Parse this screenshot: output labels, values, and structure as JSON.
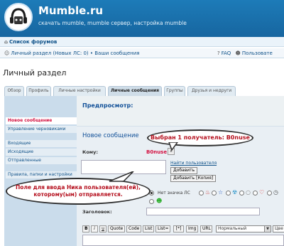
{
  "header": {
    "title": "Mumble.ru",
    "description": "скачать mumble, mumble сервер, настройка mumble"
  },
  "nav": {
    "forum_list": "Список форумов",
    "private_section": "Личный раздел (Новых ЛС: 0) • Ваши сообщения",
    "faq": "FAQ",
    "users": "Пользовате"
  },
  "page_title": "Личный раздел",
  "tabs": [
    {
      "label": "Обзор",
      "active": false
    },
    {
      "label": "Профиль",
      "active": false
    },
    {
      "label": "Личные настройки",
      "active": false
    },
    {
      "label": "Личные сообщения",
      "active": true
    },
    {
      "label": "Группы",
      "active": false
    },
    {
      "label": "Друзья и недруги",
      "active": false
    }
  ],
  "sidebar": {
    "items": [
      {
        "label": "Новое сообщение",
        "active": true
      },
      {
        "label": "Управление черновиками",
        "active": false
      },
      {
        "label": "Входящие",
        "active": false
      },
      {
        "label": "Исходящие",
        "active": false
      },
      {
        "label": "Отправленные",
        "active": false
      },
      {
        "label": "Правила, папки и настройки",
        "active": false
      }
    ]
  },
  "preview": {
    "title": "Предпросмотр:"
  },
  "compose": {
    "section_title": "Новое сообщение",
    "to_label": "Кому:",
    "recipient": "B0nuse",
    "remove_label": "x",
    "find_user": "Найти пользователя",
    "add_button": "Добавить",
    "add_bcc_button": "Добавить [Копия]",
    "no_icon_label": "Нет значка ЛС",
    "subject_label": "Заголовок:",
    "subject_value": ""
  },
  "toolbar": {
    "buttons": [
      "B",
      "i",
      "u",
      "Quote",
      "Code",
      "List",
      "List=",
      "[*]",
      "Img",
      "URL"
    ],
    "font_size": "Нормальный",
    "color": "Цве"
  },
  "callouts": {
    "selected_recipient": "Выбран 1 получатель: B0nuse",
    "input_hint_line1": "Поле для ввода Ника пользователя(ей),",
    "input_hint_line2": "которому(ым) отправляется."
  },
  "colors": {
    "header_blue": "#1d7bb8",
    "link_blue": "#105289",
    "accent_red": "#d31141"
  }
}
